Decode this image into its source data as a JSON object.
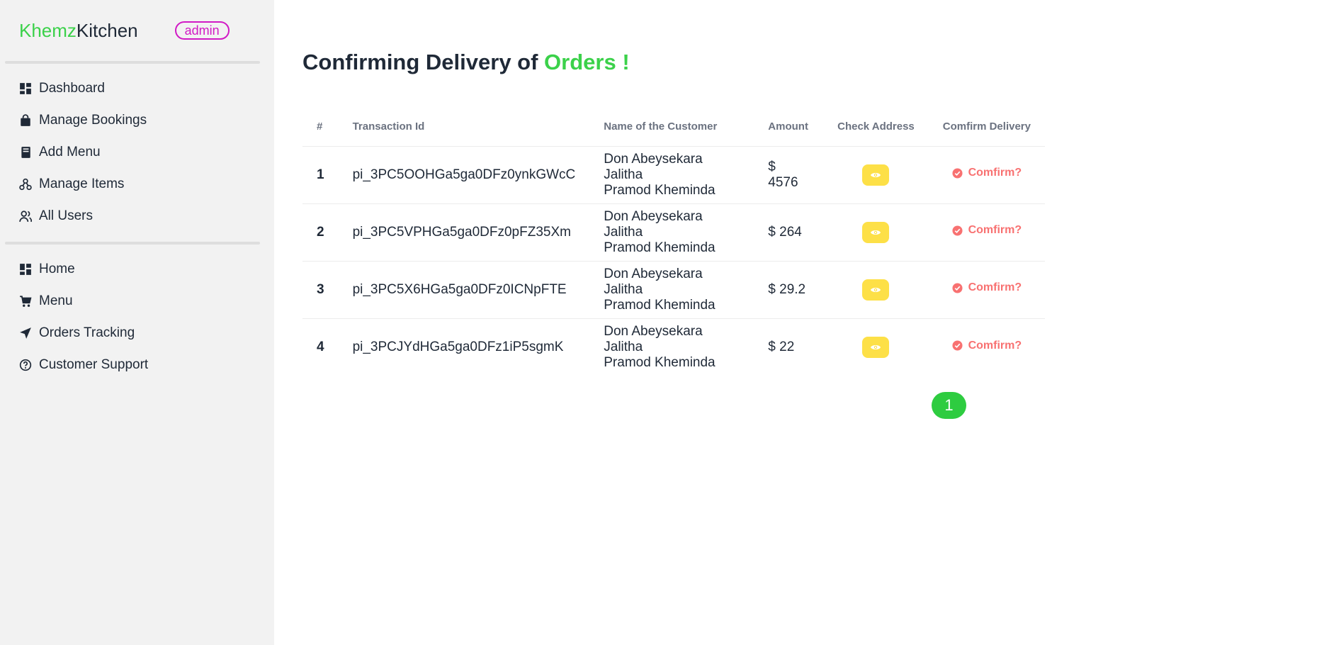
{
  "brand": {
    "name_part1": "Khemz",
    "name_part2": "Kitchen",
    "role_badge": "admin"
  },
  "sidebar": {
    "admin_items": [
      {
        "label": "Dashboard",
        "icon": "dashboard-icon"
      },
      {
        "label": "Manage Bookings",
        "icon": "shopping-bag-icon"
      },
      {
        "label": "Add Menu",
        "icon": "book-icon"
      },
      {
        "label": "Manage Items",
        "icon": "items-icon"
      },
      {
        "label": "All Users",
        "icon": "users-icon"
      }
    ],
    "general_items": [
      {
        "label": "Home",
        "icon": "dashboard-icon"
      },
      {
        "label": "Menu",
        "icon": "cart-icon"
      },
      {
        "label": "Orders Tracking",
        "icon": "location-arrow-icon"
      },
      {
        "label": "Customer Support",
        "icon": "question-circle-icon"
      }
    ]
  },
  "page": {
    "title_prefix": "Confirming Delivery of ",
    "title_accent": "Orders !"
  },
  "table": {
    "headers": [
      "#",
      "Transaction Id",
      "Name of the Customer",
      "Amount",
      "Check Address",
      "Comfirm Delivery"
    ],
    "rows": [
      {
        "num": "1",
        "transaction_id": "pi_3PC5OOHGa5ga0DFz0ynkGWcC",
        "customer_line1": "Don Abeysekara Jalitha",
        "customer_line2": "Pramod Kheminda",
        "amount": "$ 4576",
        "action": "Comfirm?"
      },
      {
        "num": "2",
        "transaction_id": "pi_3PC5VPHGa5ga0DFz0pFZ35Xm",
        "customer_line1": "Don Abeysekara Jalitha",
        "customer_line2": "Pramod Kheminda",
        "amount": "$ 264",
        "action": "Comfirm?"
      },
      {
        "num": "3",
        "transaction_id": "pi_3PC5X6HGa5ga0DFz0ICNpFTE",
        "customer_line1": "Don Abeysekara Jalitha",
        "customer_line2": "Pramod Kheminda",
        "amount": "$ 29.2",
        "action": "Comfirm?"
      },
      {
        "num": "4",
        "transaction_id": "pi_3PCJYdHGa5ga0DFz1iP5sgmK",
        "customer_line1": "Don Abeysekara Jalitha",
        "customer_line2": "Pramod Kheminda",
        "amount": "$ 22",
        "action": "Comfirm?"
      }
    ]
  },
  "pagination": {
    "current_page": "1"
  },
  "colors": {
    "brand_green": "#3bd14a",
    "badge_magenta": "#d11ac5",
    "eye_button_yellow": "#fde047",
    "confirm_red": "#f87171"
  }
}
